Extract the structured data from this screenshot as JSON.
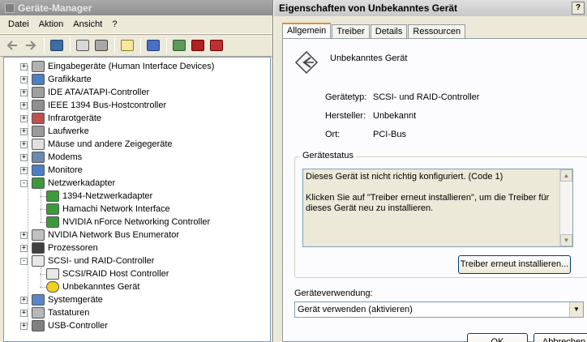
{
  "device_manager": {
    "title": "Geräte-Manager",
    "menu": [
      "Datei",
      "Aktion",
      "Ansicht",
      "?"
    ],
    "tree": [
      {
        "label": "Eingabegeräte (Human Interface Devices)",
        "icon": "keyboard-mouse-icon",
        "expander": "+",
        "level": 0
      },
      {
        "label": "Grafikkarte",
        "icon": "display-adapter-icon",
        "expander": "+",
        "level": 0
      },
      {
        "label": "IDE ATA/ATAPI-Controller",
        "icon": "ide-controller-icon",
        "expander": "+",
        "level": 0
      },
      {
        "label": "IEEE 1394 Bus-Hostcontroller",
        "icon": "firewire-icon",
        "expander": "+",
        "level": 0
      },
      {
        "label": "Infrarotgeräte",
        "icon": "infrared-icon",
        "expander": "+",
        "level": 0
      },
      {
        "label": "Laufwerke",
        "icon": "disk-drive-icon",
        "expander": "+",
        "level": 0
      },
      {
        "label": "Mäuse und andere Zeigegeräte",
        "icon": "mouse-icon",
        "expander": "+",
        "level": 0
      },
      {
        "label": "Modems",
        "icon": "modem-icon",
        "expander": "+",
        "level": 0
      },
      {
        "label": "Monitore",
        "icon": "monitor-icon",
        "expander": "+",
        "level": 0
      },
      {
        "label": "Netzwerkadapter",
        "icon": "network-adapter-icon",
        "expander": "-",
        "level": 0
      },
      {
        "label": "1394-Netzwerkadapter",
        "icon": "network-card-icon",
        "expander": "",
        "level": 1
      },
      {
        "label": "Hamachi Network Interface",
        "icon": "network-card-icon",
        "expander": "",
        "level": 1
      },
      {
        "label": "NVIDIA nForce Networking Controller",
        "icon": "network-card-icon",
        "expander": "",
        "level": 1
      },
      {
        "label": "NVIDIA Network Bus Enumerator",
        "icon": "bus-enumerator-icon",
        "expander": "+",
        "level": 0
      },
      {
        "label": "Prozessoren",
        "icon": "processor-icon",
        "expander": "+",
        "level": 0
      },
      {
        "label": "SCSI- und RAID-Controller",
        "icon": "scsi-controller-icon",
        "expander": "-",
        "level": 0
      },
      {
        "label": "SCSI/RAID Host Controller",
        "icon": "scsi-controller-icon",
        "expander": "",
        "level": 1
      },
      {
        "label": "Unbekanntes Gerät",
        "icon": "unknown-device-warning-icon",
        "expander": "",
        "level": 1
      },
      {
        "label": "Systemgeräte",
        "icon": "system-devices-icon",
        "expander": "+",
        "level": 0
      },
      {
        "label": "Tastaturen",
        "icon": "keyboard-icon",
        "expander": "+",
        "level": 0
      },
      {
        "label": "USB-Controller",
        "icon": "usb-icon",
        "expander": "+",
        "level": 0
      }
    ]
  },
  "properties": {
    "title": "Eigenschaften von Unbekanntes Gerät",
    "help_button": "?",
    "tabs": [
      "Allgemein",
      "Treiber",
      "Details",
      "Ressourcen"
    ],
    "device_name": "Unbekanntes Gerät",
    "fields": [
      {
        "label": "Gerätetyp:",
        "value": "SCSI- und RAID-Controller"
      },
      {
        "label": "Hersteller:",
        "value": "Unbekannt"
      },
      {
        "label": "Ort:",
        "value": "PCI-Bus"
      }
    ],
    "status_group": "Gerätestatus",
    "status_text": "Dieses Gerät ist nicht richtig konfiguriert. (Code 1)\n\nKlicken Sie auf \"Treiber erneut installieren\", um die Treiber für dieses Gerät neu zu installieren.",
    "reinstall_button": "Treiber erneut installieren...",
    "usage_label": "Geräteverwendung:",
    "usage_value": "Gerät verwenden (aktivieren)",
    "ok_button": "OK",
    "cancel_button": "Abbrechen"
  },
  "colors": {
    "window_bg": "#ece9d8",
    "panel_bg": "#fcfcfe",
    "active_tab_accent": "#e68b2c",
    "field_border": "#7f9db9"
  }
}
